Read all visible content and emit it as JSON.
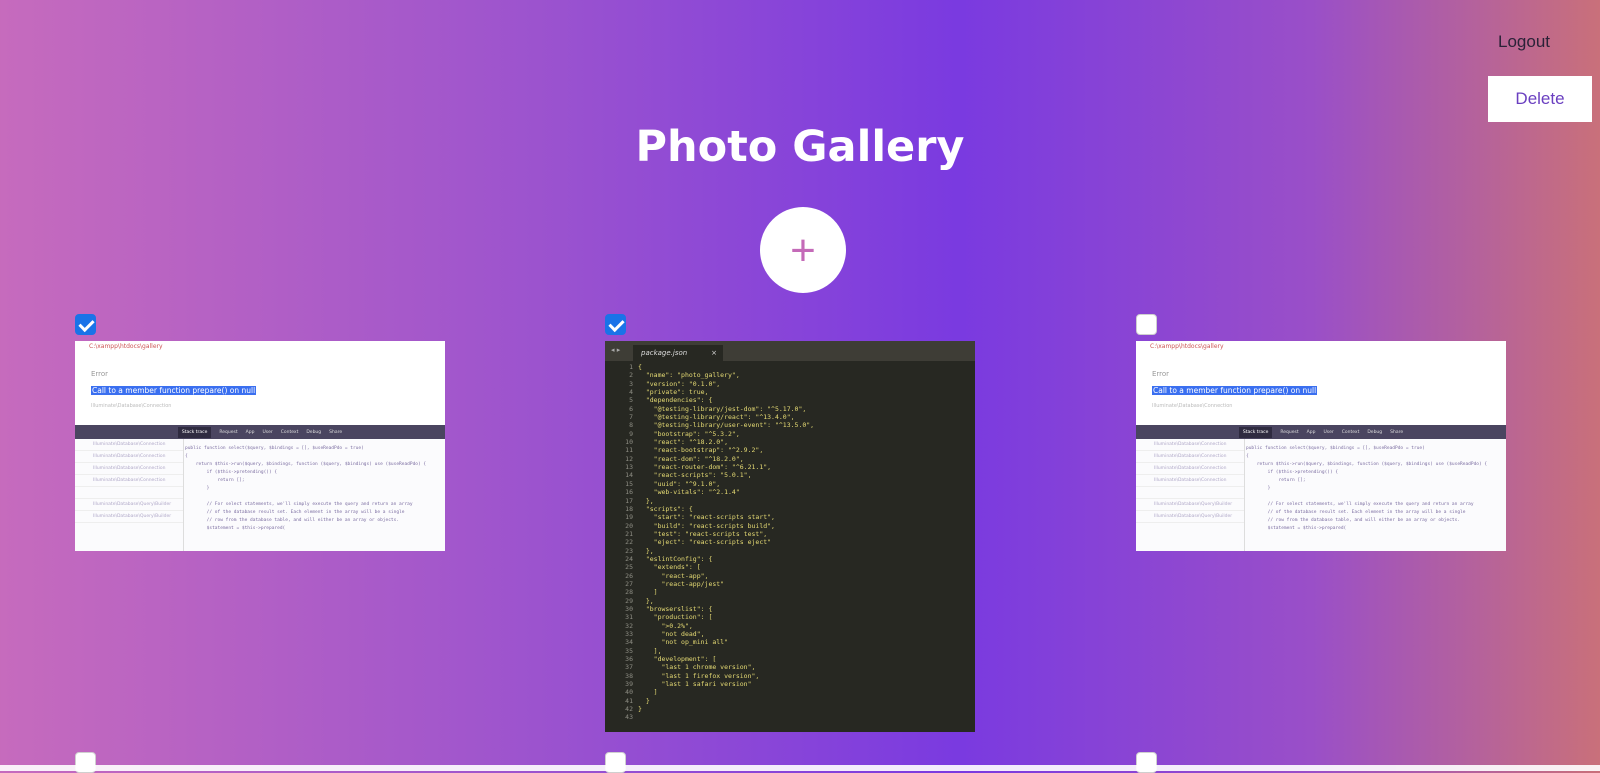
{
  "header": {
    "logout_label": "Logout",
    "delete_label": "Delete",
    "title": "Photo Gallery",
    "add_label": "+"
  },
  "photos": [
    {
      "checked": true,
      "kind": "error-screenshot"
    },
    {
      "checked": true,
      "kind": "code-screenshot"
    },
    {
      "checked": false,
      "kind": "error-screenshot"
    },
    {
      "checked": false
    },
    {
      "checked": false
    },
    {
      "checked": false
    }
  ],
  "error_shot": {
    "path": "C:\\xampp\\htdocs\\gallery",
    "label": "Error",
    "message": "Call to a member function prepare() on null",
    "sub": "Illuminate\\Database\\Connection",
    "tabs": [
      "Stack trace",
      "Request",
      "App",
      "User",
      "Context",
      "Debug",
      "Share"
    ],
    "frames": [
      "Illuminate\\Database\\Connection",
      "Illuminate\\Database\\Connection",
      "Illuminate\\Database\\Connection",
      "Illuminate\\Database\\Connection",
      "",
      "Illuminate\\Database\\Query\\Builder",
      "Illuminate\\Database\\Query\\Builder"
    ],
    "code": "public function select($query, $bindings = [], $useReadPdo = true)\n{\n    return $this->run($query, $bindings, function ($query, $bindings) use ($useReadPdo) {\n        if ($this->pretending()) {\n            return [];\n        }\n\n        // For select statements, we'll simply execute the query and return an array\n        // of the database result set. Each element in the array will be a single\n        // row from the database table, and will either be an array or objects.\n        $statement = $this->prepared("
  },
  "code_shot": {
    "filename": "package.json",
    "close": "×",
    "arrows": "◂ ▸",
    "lines": [
      "{",
      "  \"name\": \"photo_gallery\",",
      "  \"version\": \"0.1.0\",",
      "  \"private\": true,",
      "  \"dependencies\": {",
      "    \"@testing-library/jest-dom\": \"^5.17.0\",",
      "    \"@testing-library/react\": \"^13.4.0\",",
      "    \"@testing-library/user-event\": \"^13.5.0\",",
      "    \"bootstrap\": \"^5.3.2\",",
      "    \"react\": \"^18.2.0\",",
      "    \"react-bootstrap\": \"^2.9.2\",",
      "    \"react-dom\": \"^18.2.0\",",
      "    \"react-router-dom\": \"^6.21.1\",",
      "    \"react-scripts\": \"5.0.1\",",
      "    \"uuid\": \"^9.1.0\",",
      "    \"web-vitals\": \"^2.1.4\"",
      "  },",
      "  \"scripts\": {",
      "    \"start\": \"react-scripts start\",",
      "    \"build\": \"react-scripts build\",",
      "    \"test\": \"react-scripts test\",",
      "    \"eject\": \"react-scripts eject\"",
      "  },",
      "  \"eslintConfig\": {",
      "    \"extends\": [",
      "      \"react-app\",",
      "      \"react-app/jest\"",
      "    ]",
      "  },",
      "  \"browserslist\": {",
      "    \"production\": [",
      "      \">0.2%\",",
      "      \"not dead\",",
      "      \"not op_mini all\"",
      "    ],",
      "    \"development\": [",
      "      \"last 1 chrome version\",",
      "      \"last 1 firefox version\",",
      "      \"last 1 safari version\"",
      "    ]",
      "  }",
      "}",
      ""
    ]
  }
}
